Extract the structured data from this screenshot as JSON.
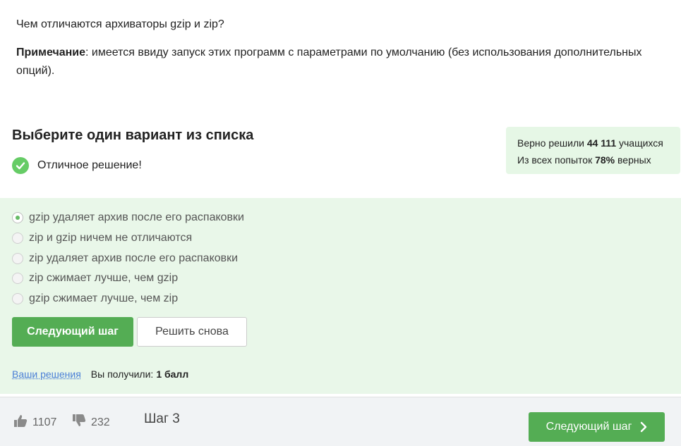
{
  "question": {
    "title": "Чем отличаются архиваторы gzip и zip?",
    "note_label": "Примечание",
    "note_text": ": имеется ввиду запуск этих программ с параметрами по умолчанию (без использования дополнительных опций)."
  },
  "task": {
    "heading": "Выберите один вариант из списка",
    "success_text": "Отличное решение!"
  },
  "stats": {
    "solved_prefix": "Верно решили ",
    "solved_count": "44 111",
    "solved_suffix": " учащихся",
    "attempts_prefix": "Из всех попыток ",
    "attempts_percent": "78%",
    "attempts_suffix": " верных"
  },
  "options": [
    {
      "label": "gzip удаляет архив после его распаковки",
      "checked": true
    },
    {
      "label": "zip и gzip ничем не отличаются",
      "checked": false
    },
    {
      "label": "zip удаляет архив после его распаковки",
      "checked": false
    },
    {
      "label": "zip сжимает лучше, чем gzip",
      "checked": false
    },
    {
      "label": "gzip сжимает лучше, чем zip",
      "checked": false
    }
  ],
  "buttons": {
    "next_step": "Следующий шаг",
    "retry": "Решить снова"
  },
  "result": {
    "solutions_link": "Ваши решения",
    "score_prefix": "Вы получили:",
    "score_value": "1 балл"
  },
  "footer": {
    "likes": "1107",
    "dislikes": "232",
    "step": "Шаг 3",
    "next_label": "Следующий шаг"
  },
  "colors": {
    "accent_green": "#54ad54",
    "answer_bg": "#e9f7e9",
    "stats_bg": "#e6f7e6",
    "link_blue": "#4a7fd6"
  },
  "icons": {
    "success": "check-circle-icon",
    "like": "thumbs-up-icon",
    "dislike": "thumbs-down-icon",
    "next": "chevron-right-icon"
  }
}
